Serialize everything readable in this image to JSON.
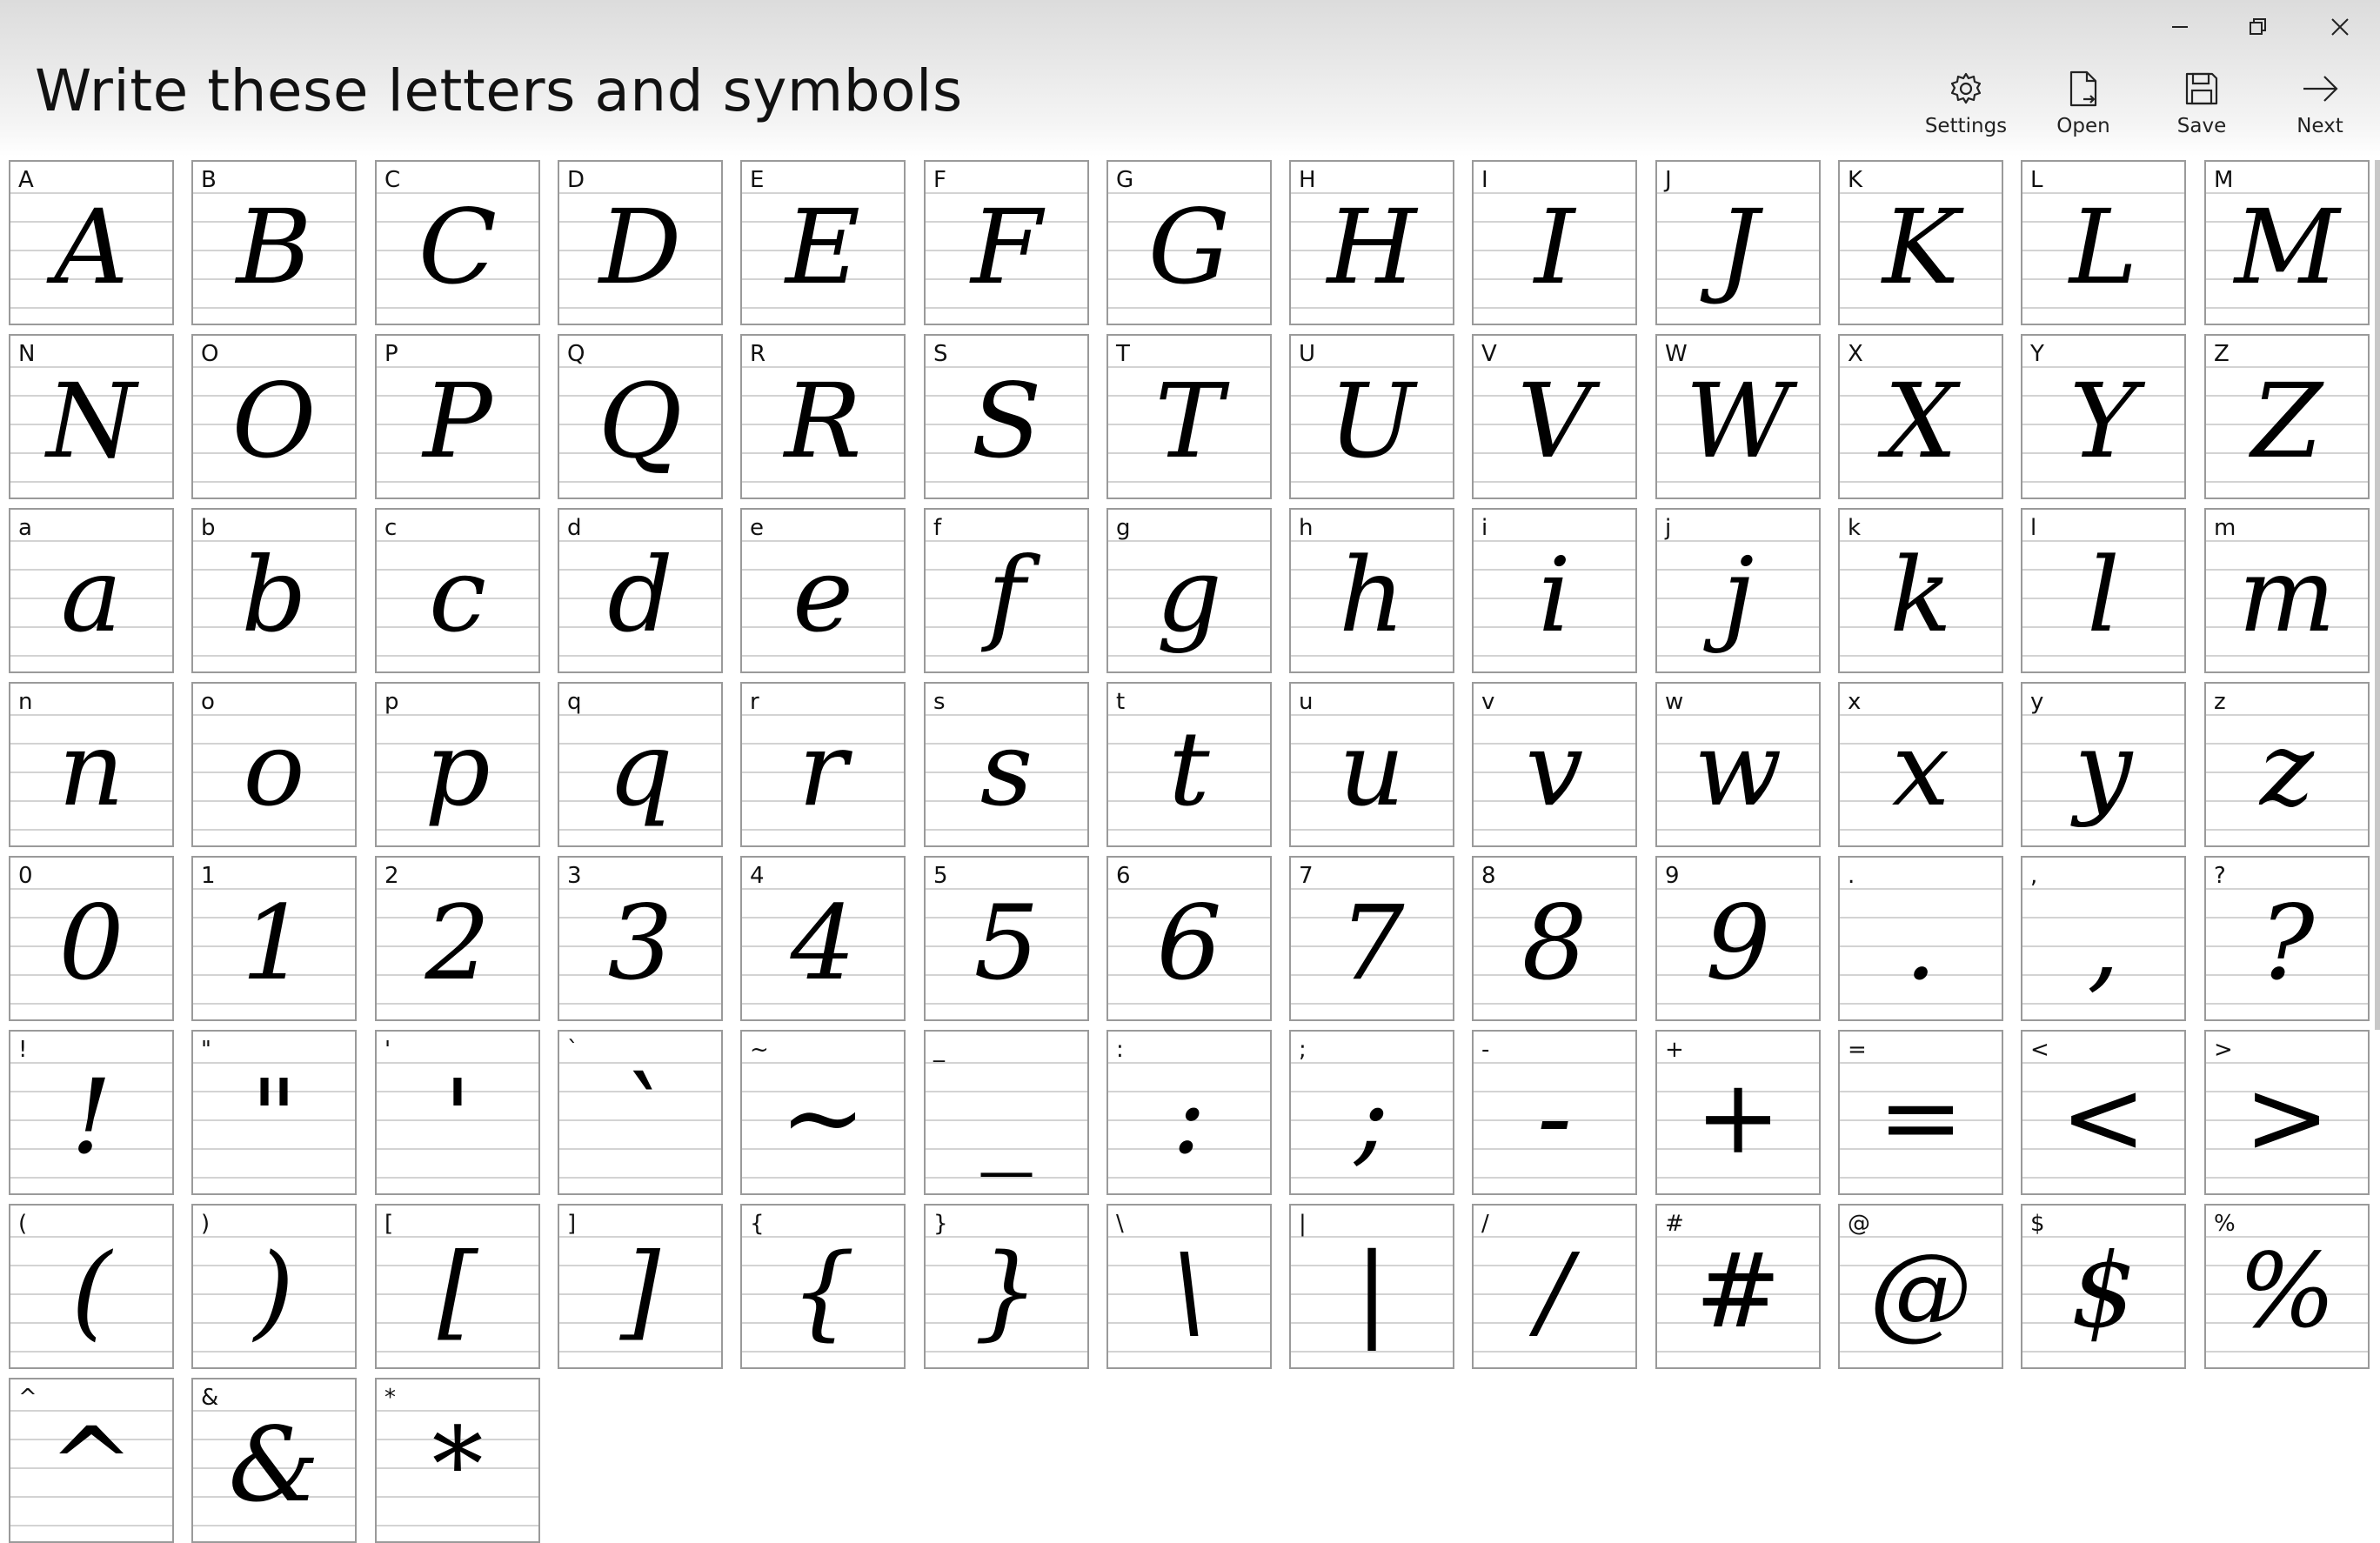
{
  "window": {
    "title": "Write these letters and symbols",
    "controls": {
      "minimize": "—",
      "restore": "❐",
      "close": "✕"
    }
  },
  "toolbar": {
    "settings_label": "Settings",
    "open_label": "Open",
    "save_label": "Save",
    "next_label": "Next"
  },
  "cells": [
    "A",
    "B",
    "C",
    "D",
    "E",
    "F",
    "G",
    "H",
    "I",
    "J",
    "K",
    "L",
    "M",
    "N",
    "O",
    "P",
    "Q",
    "R",
    "S",
    "T",
    "U",
    "V",
    "W",
    "X",
    "Y",
    "Z",
    "a",
    "b",
    "c",
    "d",
    "e",
    "f",
    "g",
    "h",
    "i",
    "j",
    "k",
    "l",
    "m",
    "n",
    "o",
    "p",
    "q",
    "r",
    "s",
    "t",
    "u",
    "v",
    "w",
    "x",
    "y",
    "z",
    "0",
    "1",
    "2",
    "3",
    "4",
    "5",
    "6",
    "7",
    "8",
    "9",
    ".",
    ",",
    "?",
    "!",
    "\"",
    "'",
    "`",
    "~",
    "_",
    ":",
    ";",
    "-",
    "+",
    "=",
    "<",
    ">",
    "(",
    ")",
    "[",
    "]",
    "{",
    "}",
    "\\",
    "|",
    "/",
    "#",
    "@",
    "$",
    "%",
    "^",
    "&",
    "*"
  ]
}
